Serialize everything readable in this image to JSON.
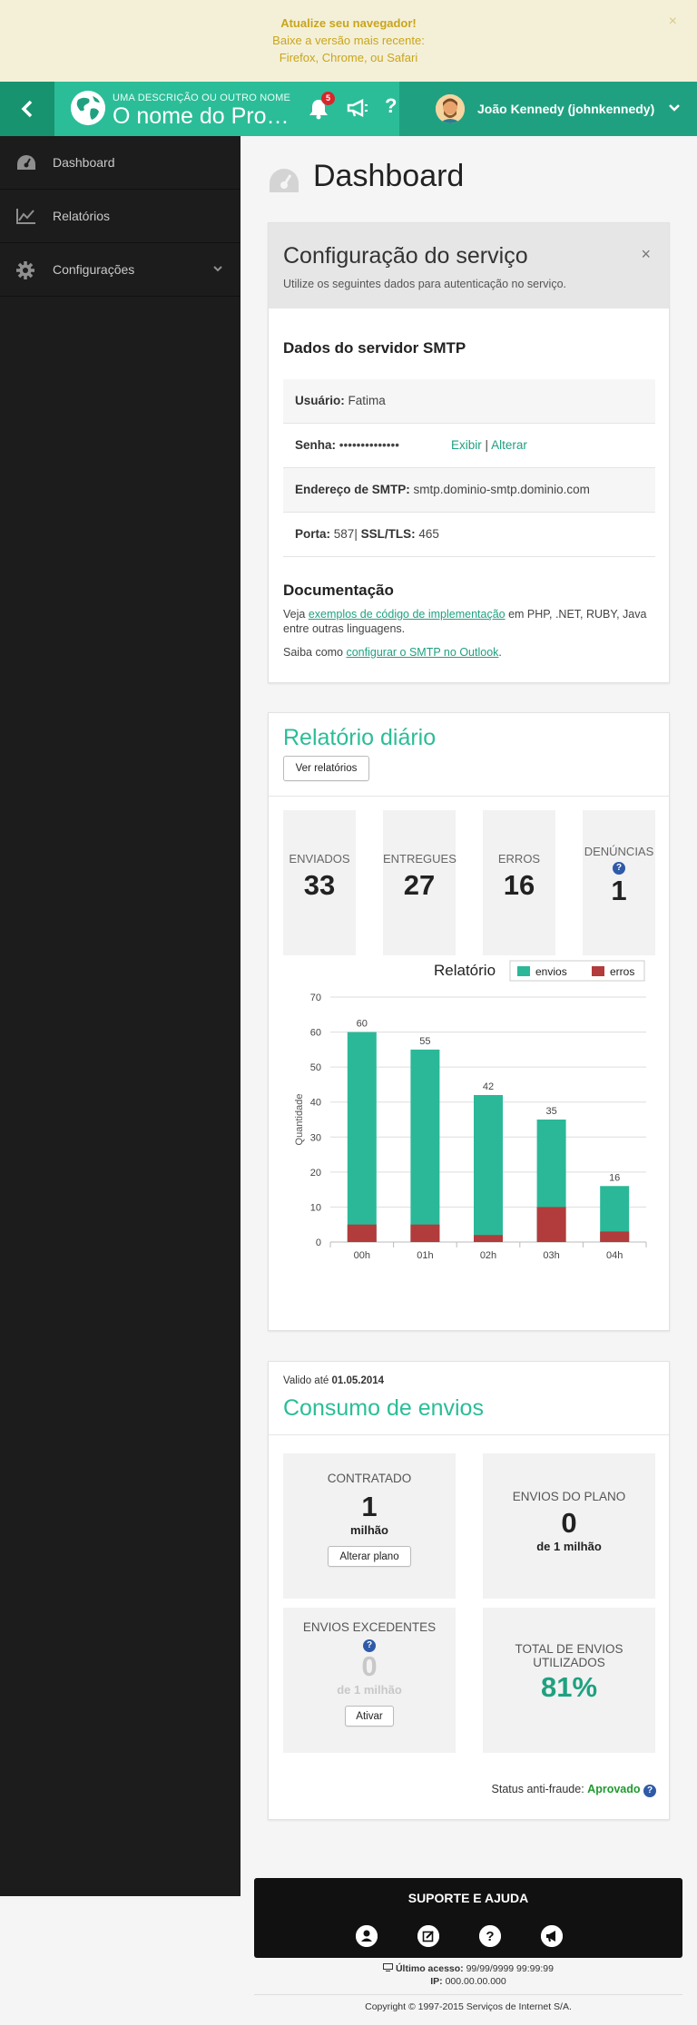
{
  "browser_warning": {
    "title": "Atualize seu navegador!",
    "line1": "Baixe a versão mais recente:",
    "line2": "Firefox, Chrome, ou Safari",
    "close": "×"
  },
  "header": {
    "back_icon": "chevron-left-icon",
    "product_desc": "UMA DESCRIÇÃO OU OUTRO NOME",
    "product_name": "O nome do Pro…",
    "notifications_count": "5",
    "help": "?",
    "user_name": "João Kennedy (johnkennedy)",
    "colors": {
      "bar": "#1fa181",
      "brand": "#2bbd98"
    }
  },
  "sidebar": {
    "items": [
      {
        "label": "Dashboard",
        "icon": "dashboard-icon"
      },
      {
        "label": "Relatórios",
        "icon": "chart-line-icon"
      },
      {
        "label": "Configurações",
        "icon": "gear-icon"
      }
    ]
  },
  "page": {
    "title": "Dashboard"
  },
  "config": {
    "title": "Configuração do serviço",
    "subtitle": "Utilize os seguintes dados para autenticação no serviço.",
    "close": "×",
    "smtp_title": "Dados do servidor SMTP",
    "user_label": "Usuário:",
    "user_value": "Fatima",
    "pass_label": "Senha:",
    "pass_value": "••••••••••••••",
    "show": "Exibir",
    "sep": "|",
    "change": "Alterar",
    "addr_label": "Endereço de SMTP:",
    "addr_value": "smtp.dominio-smtp.dominio.com",
    "port_label": "Porta:",
    "port_value": "587",
    "ssl_label": "SSL/TLS:",
    "ssl_value": "465",
    "doc_title": "Documentação",
    "doc_p1_pre": "Veja ",
    "doc_p1_link": "exemplos de código de implementação",
    "doc_p1_post": " em PHP, .NET, RUBY, Java entre outras linguagens.",
    "doc_p2_pre": "Saiba como ",
    "doc_p2_link": "configurar o SMTP no Outlook",
    "doc_p2_post": "."
  },
  "daily": {
    "title": "Relatório diário",
    "button": "Ver relatórios",
    "stats": [
      {
        "label": "ENVIADOS",
        "value": "33"
      },
      {
        "label": "ENTREGUES",
        "value": "27"
      },
      {
        "label": "ERROS",
        "value": "16"
      },
      {
        "label": "DENÚNCIAS",
        "value": "1"
      }
    ],
    "help": "?"
  },
  "chart_data": {
    "type": "bar",
    "stacked": true,
    "title": "Relatório",
    "ylabel": "Quantidade",
    "xlabel": "",
    "categories": [
      "00h",
      "01h",
      "02h",
      "03h",
      "04h"
    ],
    "series": [
      {
        "name": "envios",
        "values": [
          60,
          55,
          42,
          35,
          16
        ],
        "color": "#2bb898"
      },
      {
        "name": "erros",
        "values": [
          5,
          5,
          2,
          10,
          3
        ],
        "color": "#b23b3b"
      }
    ],
    "data_labels": [
      60,
      55,
      42,
      35,
      16
    ],
    "ylim": [
      0,
      70
    ],
    "yticks": [
      0,
      10,
      20,
      30,
      40,
      50,
      60,
      70
    ],
    "grid": true,
    "legend": "top-right"
  },
  "consumo": {
    "valid_prefix": "Valido até ",
    "valid_date": "01.05.2014",
    "title": "Consumo de envios",
    "contratado_label": "CONTRATADO",
    "contratado_value": "1",
    "contratado_unit": "milhão",
    "alterar": "Alterar plano",
    "plano_label": "ENVIOS DO PLANO",
    "plano_value": "0",
    "plano_unit": "de 1 milhão",
    "exced_label": "ENVIOS EXCEDENTES",
    "exced_value": "0",
    "exced_unit": "de 1 milhão",
    "ativar": "Ativar",
    "total_label_1": "TOTAL DE ENVIOS",
    "total_label_2": "UTILIZADOS",
    "total_value": "81%",
    "antifraude_label": "Status anti-fraude:",
    "antifraude_value": "Aprovado",
    "help": "?"
  },
  "footer": {
    "support_title": "SUPORTE E AJUDA",
    "support_icons": [
      "user-icon",
      "edit-icon",
      "help-icon",
      "megaphone-icon"
    ],
    "last_access_label": "Último acesso:",
    "last_access_value": "99/99/9999 99:99:99",
    "ip_label": "IP:",
    "ip_value": "000.00.00.000",
    "copyright": "Copyright © 1997-2015 Serviços de Internet S/A."
  }
}
